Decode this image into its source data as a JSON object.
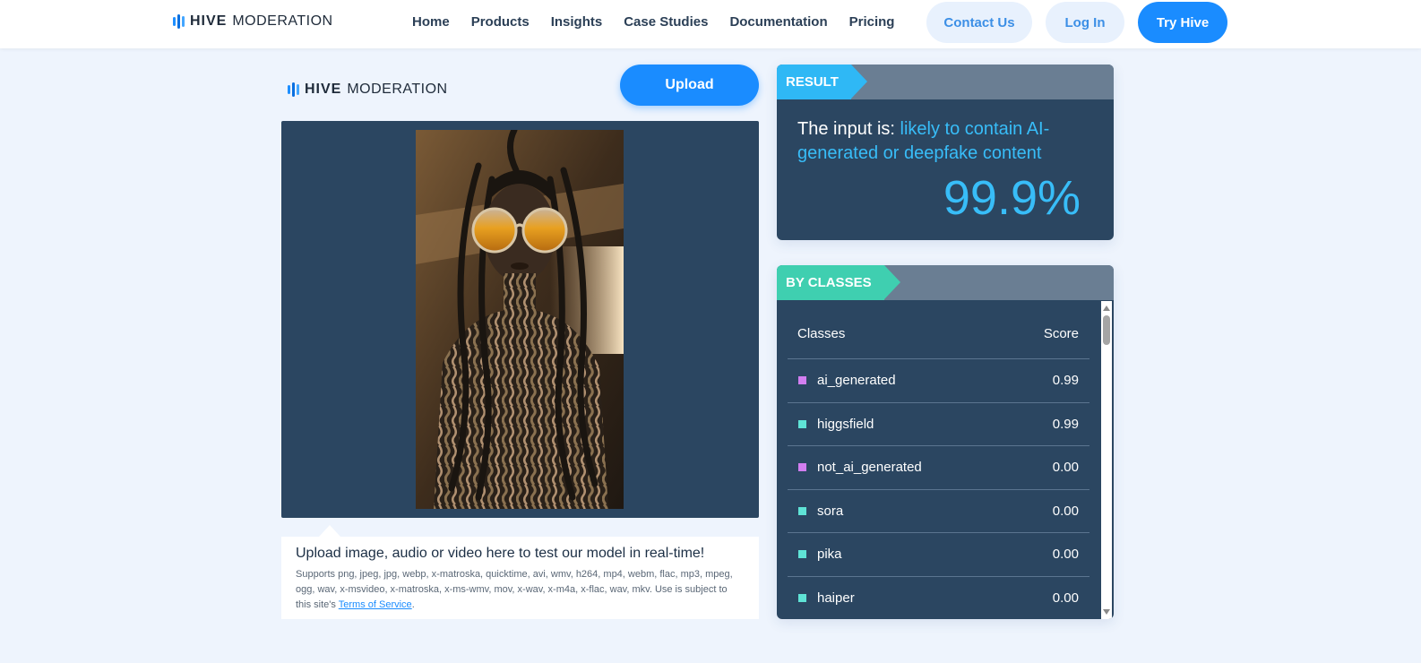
{
  "header": {
    "logo": {
      "brand": "HIVE",
      "suffix": "MODERATION",
      "icon": "hive-logo-bars-icon"
    },
    "nav": [
      "Home",
      "Products",
      "Insights",
      "Case Studies",
      "Documentation",
      "Pricing"
    ],
    "contact_label": "Contact Us",
    "login_label": "Log In",
    "try_label": "Try Hive"
  },
  "demo": {
    "logo": {
      "brand": "HIVE",
      "suffix": "MODERATION"
    },
    "upload_label": "Upload",
    "preview_image": "woman-with-braids-and-orange-sunglasses-photo",
    "info_title": "Upload image, audio or video here to test our model in real-time!",
    "info_text": "Supports png, jpeg, jpg, webp, x-matroska, quicktime, avi, wmv, h264, mp4, webm, flac, mp3, mpeg, ogg, wav, x-msvideo, x-matroska, x-ms-wmv, mov, x-wav, x-m4a, x-flac, wav, mkv. Use is subject to this site's",
    "terms_label": "Terms of Service",
    "terms_suffix": "."
  },
  "result": {
    "tag": "RESULT",
    "prefix": "The input is:",
    "verdict": "likely to contain AI-generated or deepfake content",
    "score": "99.9%"
  },
  "by_classes": {
    "tag": "BY CLASSES",
    "col_classes": "Classes",
    "col_score": "Score",
    "rows": [
      {
        "name": "ai_generated",
        "score": "0.99",
        "color": "#d27ef0"
      },
      {
        "name": "higgsfield",
        "score": "0.99",
        "color": "#5fe3d6"
      },
      {
        "name": "not_ai_generated",
        "score": "0.00",
        "color": "#d27ef0"
      },
      {
        "name": "sora",
        "score": "0.00",
        "color": "#5fe3d6"
      },
      {
        "name": "pika",
        "score": "0.00",
        "color": "#5fe3d6"
      },
      {
        "name": "haiper",
        "score": "0.00",
        "color": "#5fe3d6"
      }
    ]
  },
  "colors": {
    "accent": "#1a8cff",
    "panel": "#2b4661",
    "highlight": "#38bdf8",
    "result_tag": "#2fb8f5",
    "classes_tag": "#3fcfb0"
  }
}
